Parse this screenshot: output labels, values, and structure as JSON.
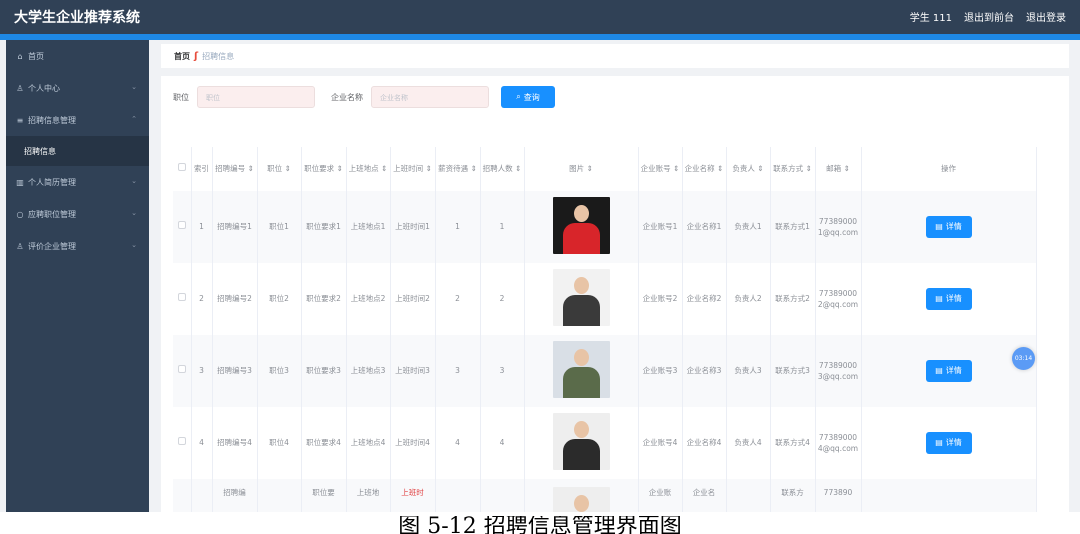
{
  "header": {
    "brand": "大学生企业推荐系统",
    "user": "学生 111",
    "back_to_admin": "退出到前台",
    "logout": "退出登录"
  },
  "sidebar": {
    "items": [
      {
        "icon": "home-icon",
        "label": "首页"
      },
      {
        "icon": "user-icon",
        "label": "个人中心"
      },
      {
        "icon": "list-icon",
        "label": "招聘信息管理"
      },
      {
        "icon": "",
        "label": "招聘信息"
      },
      {
        "icon": "building-icon",
        "label": "个人简历管理"
      },
      {
        "icon": "circle-icon",
        "label": "应聘职位管理"
      },
      {
        "icon": "person-icon",
        "label": "评价企业管理"
      }
    ]
  },
  "breadcrumb": {
    "home": "首页",
    "current": "招聘信息"
  },
  "search": {
    "position_label": "职位",
    "position_placeholder": "职位",
    "company_label": "企业名称",
    "company_placeholder": "企业名称",
    "query_button": "查询"
  },
  "table": {
    "headers": [
      "索引",
      "招聘编号 ⇕",
      "职位 ⇕",
      "职位要求 ⇕",
      "上班地点 ⇕",
      "上班时间 ⇕",
      "薪资待遇 ⇕",
      "招聘人数 ⇕",
      "图片 ⇕",
      "企业账号 ⇕",
      "企业名称 ⇕",
      "负责人 ⇕",
      "联系方式 ⇕",
      "邮箱 ⇕",
      "操作"
    ],
    "rows": [
      {
        "index": "1",
        "recruit_no": "招聘编号1",
        "position": "职位1",
        "requirement": "职位要求1",
        "location": "上班地点1",
        "work_time": "上班时间1",
        "salary": "1",
        "count": "1",
        "account": "企业账号1",
        "company": "企业名称1",
        "leader": "负责人1",
        "contact": "联系方式1",
        "email": "773890001@qq.com",
        "action": "详情"
      },
      {
        "index": "2",
        "recruit_no": "招聘编号2",
        "position": "职位2",
        "requirement": "职位要求2",
        "location": "上班地点2",
        "work_time": "上班时间2",
        "salary": "2",
        "count": "2",
        "account": "企业账号2",
        "company": "企业名称2",
        "leader": "负责人2",
        "contact": "联系方式2",
        "email": "773890002@qq.com",
        "action": "详情"
      },
      {
        "index": "3",
        "recruit_no": "招聘编号3",
        "position": "职位3",
        "requirement": "职位要求3",
        "location": "上班地点3",
        "work_time": "上班时间3",
        "salary": "3",
        "count": "3",
        "account": "企业账号3",
        "company": "企业名称3",
        "leader": "负责人3",
        "contact": "联系方式3",
        "email": "773890003@qq.com",
        "action": "详情"
      },
      {
        "index": "4",
        "recruit_no": "招聘编号4",
        "position": "职位4",
        "requirement": "职位要求4",
        "location": "上班地点4",
        "work_time": "上班时间4",
        "salary": "4",
        "count": "4",
        "account": "企业账号4",
        "company": "企业名称4",
        "leader": "负责人4",
        "contact": "联系方式4",
        "email": "773890004@qq.com",
        "action": "详情"
      },
      {
        "index": "",
        "recruit_no": "招聘编",
        "position": "",
        "requirement": "职位要",
        "location": "上班地",
        "work_time": "上班时",
        "salary": "",
        "count": "",
        "account": "企业账",
        "company": "企业名",
        "leader": "",
        "contact": "联系方",
        "email": "773890",
        "action": ""
      }
    ]
  },
  "timer": "03:14",
  "caption": "图 5-12 招聘信息管理界面图",
  "colors": {
    "topbar": "#304156",
    "accent": "#1890ff",
    "sidebar": "#304156"
  }
}
